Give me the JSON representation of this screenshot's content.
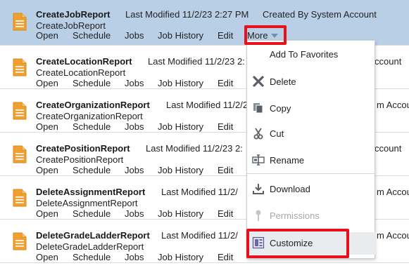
{
  "rows": [
    {
      "title": "CreateJobReport",
      "last_modified": "Last Modified 11/2/23 2:27 PM",
      "created_by": "Created By System Account",
      "subtitle": "CreateJobReport",
      "selected": true
    },
    {
      "title": "CreateLocationReport",
      "last_modified": "Last Modified 11/2/23 2:",
      "created_by": "ccount",
      "subtitle": "CreateLocationReport"
    },
    {
      "title": "CreateOrganizationReport",
      "last_modified": "Last Modified 11/2/23",
      "created_by": "m Accou",
      "subtitle": "CreateOrganizationReport"
    },
    {
      "title": "CreatePositionReport",
      "last_modified": "Last Modified 11/2/23 2:",
      "created_by": "ccount",
      "subtitle": "CreatePositionReport"
    },
    {
      "title": "DeleteAssignmentReport",
      "last_modified": "Last Modified 11/2/",
      "created_by": "m Accou",
      "subtitle": "DeleteAssignmentReport"
    },
    {
      "title": "DeleteGradeLadderReport",
      "last_modified": "Last Modified 11/2/",
      "created_by": "m Accou",
      "subtitle": "DeleteGradeLadderReport"
    }
  ],
  "actions": {
    "open": "Open",
    "schedule": "Schedule",
    "jobs": "Jobs",
    "job_history": "Job History",
    "edit": "Edit",
    "more": "More"
  },
  "menu": {
    "items": [
      {
        "label": "Add To Favorites",
        "icon": "none"
      },
      {
        "label": "Delete",
        "icon": "delete-x-icon"
      },
      {
        "label": "Copy",
        "icon": "copy-icon"
      },
      {
        "label": "Cut",
        "icon": "scissors-icon"
      },
      {
        "label": "Rename",
        "icon": "rename-icon"
      },
      {
        "label": "Download",
        "icon": "download-icon"
      },
      {
        "label": "Permissions",
        "icon": "key-icon",
        "disabled": true
      },
      {
        "label": "Customize",
        "icon": "customize-icon",
        "hovered": true
      }
    ]
  },
  "colors": {
    "selected_row": "#b9cfe6",
    "doc_icon": "#f0a030",
    "highlight": "#e8101a"
  }
}
